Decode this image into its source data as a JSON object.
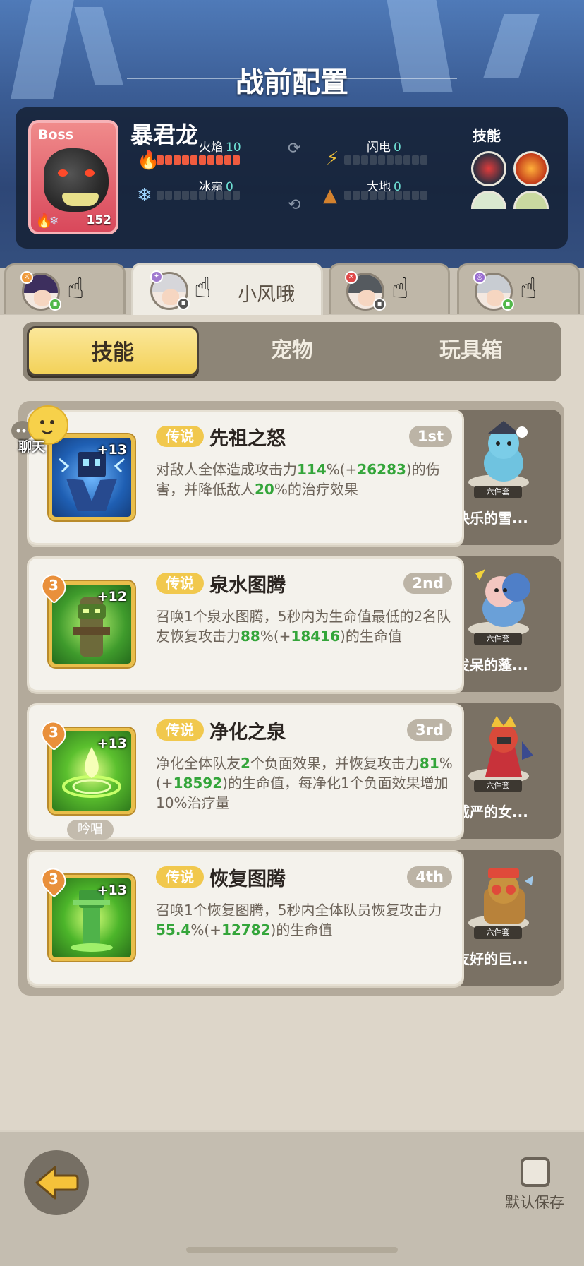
{
  "page": {
    "title": "战前配置"
  },
  "boss": {
    "tag": "Boss",
    "name": "暴君龙",
    "level": "152",
    "skills_label": "技能",
    "stats": [
      {
        "label": "火焰",
        "value": "10",
        "icon": "flame-icon",
        "filled": 10
      },
      {
        "label": "闪电",
        "value": "0",
        "icon": "lightning-icon",
        "filled": 0
      },
      {
        "label": "冰霜",
        "value": "0",
        "icon": "snowflake-icon",
        "filled": 0
      },
      {
        "label": "大地",
        "value": "0",
        "icon": "earth-icon",
        "filled": 0
      }
    ]
  },
  "heroes": [
    {
      "name": "",
      "active": false
    },
    {
      "name": "小风哦",
      "active": true
    },
    {
      "name": "",
      "active": false
    },
    {
      "name": "",
      "active": false
    }
  ],
  "tabs": [
    {
      "label": "技能",
      "active": true
    },
    {
      "label": "宠物",
      "active": false
    },
    {
      "label": "玩具箱",
      "active": false
    }
  ],
  "chat_label": "聊天",
  "skills": [
    {
      "rarity": "传说",
      "name": "先祖之怒",
      "slot": "1st",
      "level": "+13",
      "rank": "",
      "desc_parts": [
        "对敌人全体造成攻击力",
        "114",
        "%(+",
        "26283",
        ")的伤害，并降低敌人",
        "20",
        "%的治疗效果"
      ],
      "pet_name": "快乐的雪...",
      "pet_set": "六件套",
      "chant": ""
    },
    {
      "rarity": "传说",
      "name": "泉水图腾",
      "slot": "2nd",
      "level": "+12",
      "rank": "3",
      "desc_parts": [
        "召唤1个泉水图腾，5秒内为生命值最低的2名队友恢复攻击力",
        "88",
        "%(+",
        "18416",
        ")的生命值"
      ],
      "pet_name": "发呆的蓬...",
      "pet_set": "六件套",
      "chant": ""
    },
    {
      "rarity": "传说",
      "name": "净化之泉",
      "slot": "3rd",
      "level": "+13",
      "rank": "3",
      "desc_parts": [
        "净化全体队友",
        "2",
        "个负面效果，并恢复攻击力",
        "81",
        "%(+",
        "18592",
        ")的生命值，每净化1个负面效果增加10%治疗量"
      ],
      "pet_name": "威严的女...",
      "pet_set": "六件套",
      "chant": "吟唱"
    },
    {
      "rarity": "传说",
      "name": "恢复图腾",
      "slot": "4th",
      "level": "+13",
      "rank": "3",
      "desc_parts": [
        "召唤1个恢复图腾，5秒内全体队员恢复攻击力",
        "55.4",
        "%(+",
        "12782",
        ")的生命值"
      ],
      "pet_name": "友好的巨...",
      "pet_set": "六件套",
      "chant": ""
    }
  ],
  "footer": {
    "save_label": "默认保存"
  },
  "colors": {
    "accent": "#f3d25a",
    "highlight_green": "#34a53a",
    "fire": "#ef5b3f"
  }
}
